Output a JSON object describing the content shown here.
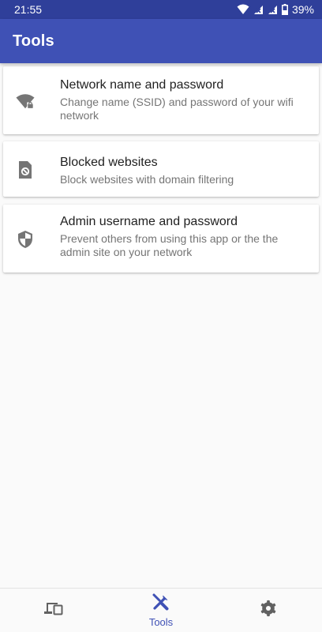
{
  "status_bar": {
    "time": "21:55",
    "battery": "39%",
    "icons": [
      "wifi-icon",
      "signal-icon",
      "signal-icon",
      "battery-icon"
    ]
  },
  "app_bar": {
    "title": "Tools"
  },
  "tools": [
    {
      "icon": "wifi-lock-icon",
      "title": "Network name and password",
      "description": "Change name (SSID) and password of your wifi network"
    },
    {
      "icon": "blocked-file-icon",
      "title": "Blocked websites",
      "description": "Block websites with domain filtering"
    },
    {
      "icon": "shield-icon",
      "title": "Admin username and password",
      "description": "Prevent others from using this app or the the admin site on your network"
    }
  ],
  "bottom_nav": {
    "items": [
      {
        "icon": "devices-icon",
        "label": ""
      },
      {
        "icon": "tools-icon",
        "label": "Tools",
        "selected": true
      },
      {
        "icon": "settings-icon",
        "label": ""
      }
    ]
  },
  "colors": {
    "primary": "#3f51b5",
    "status_bar": "#2f3f9a",
    "background": "#fafafa",
    "icon_gray": "#757575"
  }
}
